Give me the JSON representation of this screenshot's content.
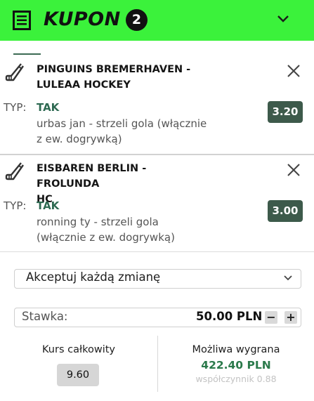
{
  "header": {
    "title": "KUPON",
    "count": "2",
    "background": "#3bf23b",
    "menu_icon": "receipt-list-icon",
    "collapse_icon": "chevron-down-icon"
  },
  "bets": [
    {
      "sport_icon": "hockey-stick-icon",
      "event_line1": "PINGUINS BREMERHAVEN -",
      "event_line2": "LULEAA HOCKEY",
      "typ_label": "TYP:",
      "pick": "TAK",
      "market_line1": "urbas jan - strzeli gola (włącznie",
      "market_line2": "z ew. dogrywką)",
      "odds": "3.20"
    },
    {
      "sport_icon": "hockey-stick-icon",
      "event_line1": "EISBAREN BERLIN - FROLUNDA",
      "event_line2": "HC",
      "typ_label": "TYP:",
      "pick": "TAK",
      "market_line1": "ronning ty - strzeli gola",
      "market_line2": "(włącznie z ew. dogrywką)",
      "odds": "3.00"
    }
  ],
  "accept_changes": {
    "selected": "Akceptuj każdą zmianę"
  },
  "stake": {
    "label": "Stawka:",
    "value": "50.00 PLN",
    "minus": "−",
    "plus": "+"
  },
  "summary": {
    "total_odds_label": "Kurs całkowity",
    "total_odds_value": "9.60",
    "win_label": "Możliwa wygrana",
    "win_value": "422.40 PLN",
    "coefficient_text": "współczynnik 0.88"
  },
  "colors": {
    "accent_green": "#3bf23b",
    "odds_badge": "#3d5a4b",
    "pick_text": "#2e6a52",
    "win_text": "#2b7a4b"
  }
}
